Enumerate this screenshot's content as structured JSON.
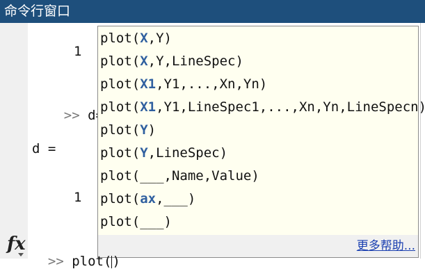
{
  "window": {
    "title": "命令行窗口"
  },
  "history": [
    {
      "text": "1"
    },
    {
      "prompt": ">>",
      "text": "d=d"
    },
    {
      "text": "d ="
    },
    {
      "text": "1"
    }
  ],
  "autocomplete": {
    "signatures": [
      [
        {
          "t": "plot("
        },
        {
          "t": "X",
          "a": true
        },
        {
          "t": ",Y)"
        }
      ],
      [
        {
          "t": "plot("
        },
        {
          "t": "X",
          "a": true
        },
        {
          "t": ",Y,LineSpec)"
        }
      ],
      [
        {
          "t": "plot("
        },
        {
          "t": "X1",
          "a": true
        },
        {
          "t": ",Y1,...,Xn,Yn)"
        }
      ],
      [
        {
          "t": "plot("
        },
        {
          "t": "X1",
          "a": true
        },
        {
          "t": ",Y1,LineSpec1,...,Xn,Yn,LineSpecn)"
        }
      ],
      [
        {
          "t": "plot("
        },
        {
          "t": "Y",
          "a": true
        },
        {
          "t": ")"
        }
      ],
      [
        {
          "t": "plot("
        },
        {
          "t": "Y",
          "a": true
        },
        {
          "t": ",LineSpec)"
        }
      ],
      [
        {
          "t": "plot(___,Name,Value)"
        }
      ],
      [
        {
          "t": "plot("
        },
        {
          "t": "ax",
          "a": true
        },
        {
          "t": ",___)"
        }
      ],
      [
        {
          "t": "plot(___)"
        }
      ]
    ],
    "more_help": "更多帮助..."
  },
  "command_line": {
    "prompt": ">>",
    "input": "plot()"
  },
  "icons": {
    "fx": "fx-function-browser-icon"
  },
  "colors": {
    "title_bg": "#1e4f7c",
    "popup_bg": "#fffff0",
    "arg": "#2f5f9f",
    "link": "#1a3fb0"
  }
}
